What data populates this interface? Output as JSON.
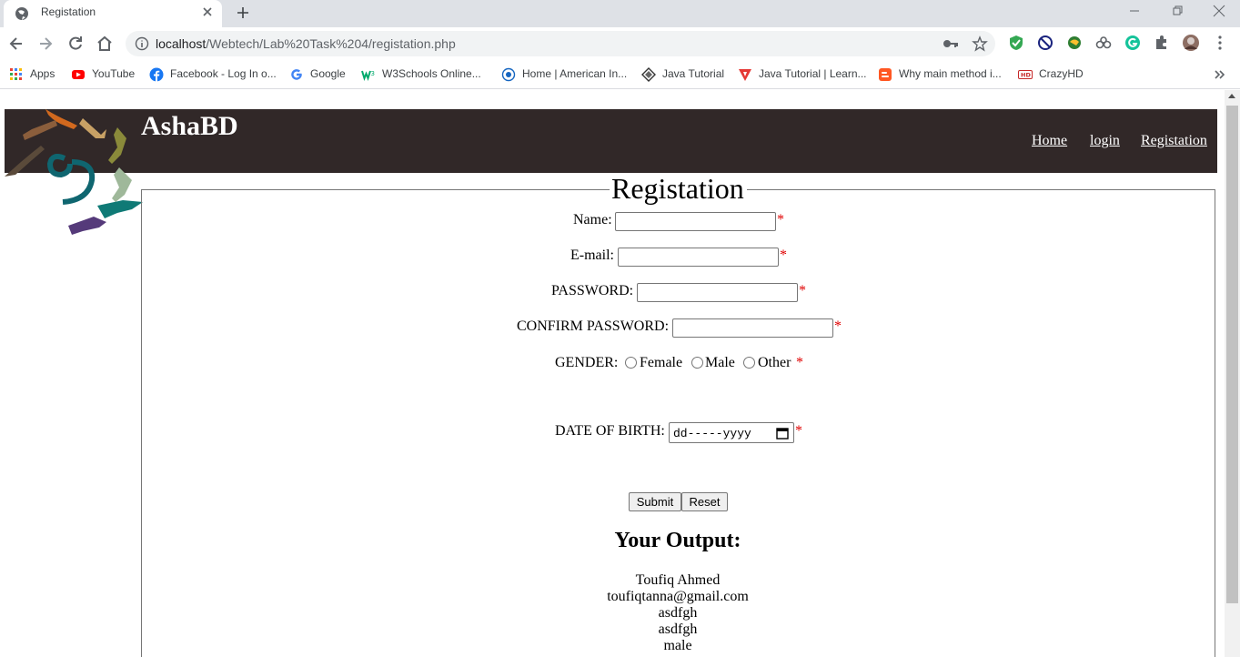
{
  "browser": {
    "tab_title": "Registation",
    "url_host": "localhost",
    "url_path": "/Webtech/Lab%20Task%204/registation.php"
  },
  "bookmarks": [
    {
      "label": "Apps",
      "icon": "apps-grid-icon"
    },
    {
      "label": "YouTube",
      "icon": "youtube-icon"
    },
    {
      "label": "Facebook - Log In o...",
      "icon": "facebook-icon"
    },
    {
      "label": "Google",
      "icon": "google-icon"
    },
    {
      "label": "W3Schools Online...",
      "icon": "w3schools-icon"
    },
    {
      "label": "Home | American In...",
      "icon": "globe-icon"
    },
    {
      "label": "Java Tutorial",
      "icon": "diamond-icon"
    },
    {
      "label": "Java Tutorial | Learn...",
      "icon": "javatpoint-icon"
    },
    {
      "label": "Why main method i...",
      "icon": "blogger-icon"
    },
    {
      "label": "CrazyHD",
      "icon": "hd-icon"
    }
  ],
  "site": {
    "title": "AshaBD",
    "nav": [
      "Home",
      "login",
      "Registation"
    ]
  },
  "form": {
    "legend": "Registation",
    "name_label": "Name:",
    "email_label": "E-mail:",
    "password_label": "PASSWORD:",
    "confirm_label": "CONFIRM PASSWORD:",
    "gender_label": "GENDER:",
    "gender_options": [
      "Female",
      "Male",
      "Other"
    ],
    "dob_label": "DATE OF BIRTH:",
    "dob_placeholder": "dd-----yyyy",
    "required_mark": "*",
    "submit_label": "Submit",
    "reset_label": "Reset"
  },
  "output": {
    "title": "Your Output:",
    "lines": [
      "Toufiq Ahmed",
      "toufiqtanna@gmail.com",
      "asdfgh",
      "asdfgh",
      "male"
    ]
  },
  "colors": {
    "header_bg": "#312828",
    "required": "#e00000"
  }
}
